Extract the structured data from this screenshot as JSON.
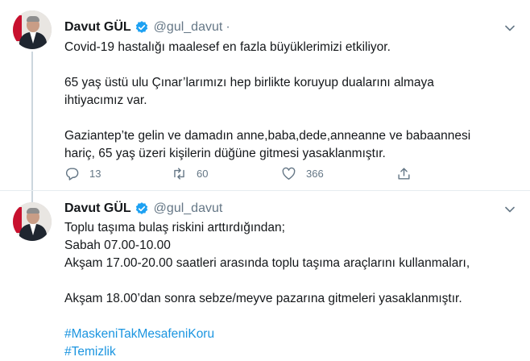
{
  "tweets": [
    {
      "name": "Davut GÜL",
      "handle": "@gul_davut",
      "separator": "·",
      "lines": [
        "Covid-19 hastalığı maalesef en fazla büyüklerimizi etkiliyor.",
        "",
        "65 yaş üstü ulu Çınar’larımızı hep birlikte koruyup dualarını almaya",
        "ihtiyacımız var.",
        "",
        "Gaziantep’te gelin ve damadın anne,baba,dede,anneanne ve babaannesi",
        "hariç, 65 yaş üzeri kişilerin düğüne gitmesi yasaklanmıştır."
      ],
      "reply_count": "13",
      "retweet_count": "60",
      "like_count": "366"
    },
    {
      "name": "Davut GÜL",
      "handle": "@gul_davut",
      "lines": [
        "Toplu taşıma bulaş riskini arttırdığından;",
        "Sabah 07.00-10.00",
        "Akşam 17.00-20.00 saatleri arasında toplu taşıma araçlarını kullanmaları,",
        "",
        "Akşam 18.00’dan sonra sebze/meyve pazarına gitmeleri yasaklanmıştır.",
        "",
        "#MaskeniTakMesafeniKoru",
        "#Temizlik"
      ]
    }
  ],
  "icons": {
    "verified": "verified-badge-icon",
    "caret": "chevron-down-icon",
    "reply": "reply-icon",
    "retweet": "retweet-icon",
    "like": "heart-icon",
    "share": "share-icon"
  },
  "colors": {
    "accent": "#1da1f2",
    "hashtag": "#1b95e0",
    "muted": "#657786",
    "text": "#14171a"
  }
}
